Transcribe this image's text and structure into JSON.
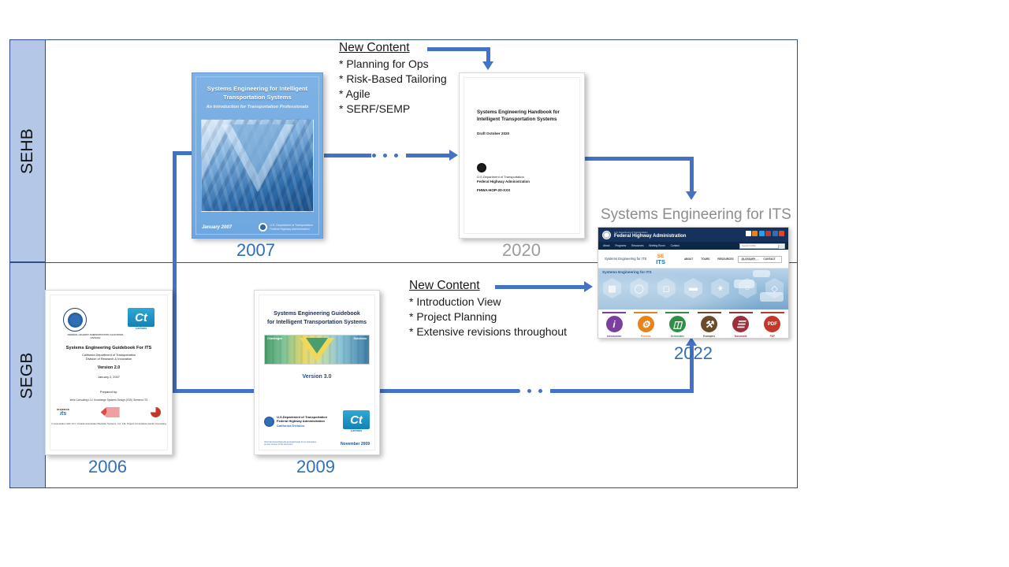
{
  "diagram": {
    "title_right": "Systems Engineering for ITS",
    "lanes": [
      {
        "id": "sehb",
        "label": "SEHB"
      },
      {
        "id": "segb",
        "label": "SEGB"
      }
    ]
  },
  "new_content_sehb": {
    "heading": "New Content",
    "items": [
      "* Planning for Ops",
      "* Risk-Based Tailoring",
      "* Agile",
      "* SERF/SEMP"
    ]
  },
  "new_content_segb": {
    "heading": "New Content",
    "items": [
      "* Introduction  View",
      "* Project Planning",
      "* Extensive revisions throughout"
    ]
  },
  "years": {
    "y2006": "2006",
    "y2007": "2007",
    "y2009": "2009",
    "y2020": "2020",
    "y2022": "2022"
  },
  "doc_2007": {
    "title": "Systems Engineering for Intelligent Transportation Systems",
    "subtitle": "An Introduction for Transportation Professionals",
    "date": "January 2007",
    "agency_line1": "U.S. Department of Transportation",
    "agency_line2": "Federal Highway Administration"
  },
  "doc_2020": {
    "title": "Systems Engineering Handbook for Intelligent Transportation Systems",
    "draft": "Draft October 2020",
    "agency_line1": "U.S.Department of Transportation",
    "agency_line2": "Federal Highway Administration",
    "code": "FHWA-HOP-20-XXX"
  },
  "doc_2006": {
    "seal_caption": "FEDERAL HIGHWAY ADMINISTRATION CALIFORNIA DIVISION",
    "caltrans_mark": "Ct",
    "caltrans_caption": "Caltrans",
    "title": "Systems Engineering Guidebook For ITS",
    "org_line1": "California Department of Transportation",
    "org_line2": "Division of Research & Innovation",
    "version": "Version 2.0",
    "date": "January 2, 2007",
    "prepared_label": "Prepared by:",
    "prepared_lines": "Iteris Consulting LLC  Knowledge Systems Design (KSD)  Siemens ITS",
    "partner_siemens": "SIEMENS",
    "partner_its": "its",
    "assoc_lines": "In association with: R.C. Arcade Associates  Marsden Systems, Inc.  L&L Project Consultants  Aeolis Consulting"
  },
  "doc_2009": {
    "title_line1": "Systems Engineering Guidebook",
    "title_line2": "for Intelligent Transportation Systems",
    "band_left": "Challenges",
    "band_right": "Solutions",
    "version": "Version 3.0",
    "agency_line1": "U.S.Department of Transportation",
    "agency_line2": "Federal Highway Administration",
    "agency_line3": "California Division",
    "caltrans_mark": "Ct",
    "caltrans_caption": "Caltrans",
    "note": "Visit http://www.fhwa.dot.gov/cadiv/segb for an interactive, on-line version of this document",
    "date": "November 2009"
  },
  "site_2022": {
    "dept": "U.S. Department of Transportation",
    "agency": "Federal Highway Administration",
    "top_nav": [
      "About",
      "Programs",
      "Resources",
      "Briefing Room",
      "Contact"
    ],
    "top_search_placeholder": "Search FHWA",
    "brand": "Systems Engineering for ITS",
    "logo_se": "SE",
    "logo_its": "ITS",
    "menu": [
      "ABOUT",
      "TOURS",
      "RESOURCES",
      "GLOSSARY",
      "CONTACT"
    ],
    "search_placeholder": "Search SE for ITS",
    "hero_caption": "Systems Engineering for ITS",
    "icons": [
      {
        "label": "Introduction",
        "glyph": "i",
        "color": "#7b3f9e",
        "bar": "#7b3f9e"
      },
      {
        "label": "Process",
        "glyph": "⚙",
        "color": "#e8821a",
        "bar": "#e8821a"
      },
      {
        "label": "Deliverable",
        "glyph": "▭",
        "color": "#2f8f46",
        "bar": "#2f8f46"
      },
      {
        "label": "Examples",
        "glyph": "⚙",
        "color": "#6b4a2c",
        "bar": "#6b4a2c"
      },
      {
        "label": "Document",
        "glyph": "☰",
        "color": "#9b2franch",
        "bar": "#9b2f3a"
      },
      {
        "label": "PDF",
        "glyph": "PDF",
        "color": "#c0392b",
        "bar": "#c0392b"
      }
    ]
  },
  "colors": {
    "connector": "#4472c4",
    "lane_band": "#b4c7e7",
    "frame": "#2c4f8c",
    "year_active": "#2f6fb5",
    "year_muted": "#9c9c9c"
  }
}
